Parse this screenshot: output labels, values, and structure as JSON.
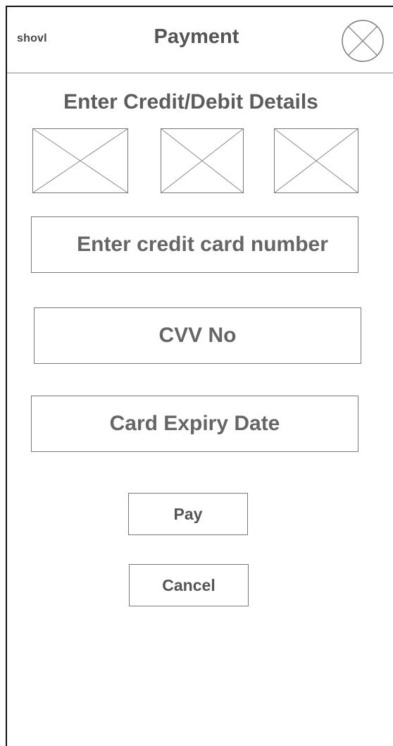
{
  "header": {
    "brand": "shovl",
    "title": "Payment",
    "close_icon": "close-circle-x-icon"
  },
  "section": {
    "title": "Enter Credit/Debit Details"
  },
  "card_images": [
    {
      "icon": "image-placeholder-icon"
    },
    {
      "icon": "image-placeholder-icon"
    },
    {
      "icon": "image-placeholder-icon"
    }
  ],
  "form": {
    "card_number_placeholder": "Enter credit card number",
    "cvv_placeholder": "CVV No",
    "expiry_placeholder": "Card Expiry Date"
  },
  "buttons": {
    "pay_label": "Pay",
    "cancel_label": "Cancel"
  },
  "colors": {
    "frame": "#111111",
    "border": "#777777",
    "text": "#5f5f5f",
    "background": "#ffffff"
  }
}
